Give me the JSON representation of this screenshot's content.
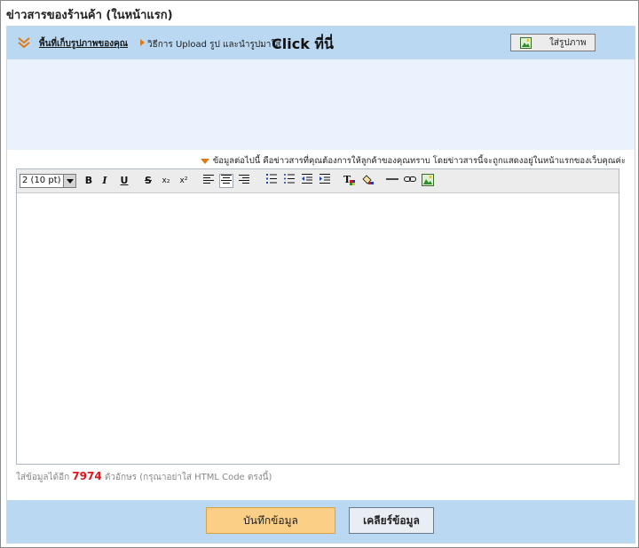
{
  "title": "ข่าวสารของร้านค้า (ในหน้าแรก)",
  "upload": {
    "link_label": "พื้นที่เก็บรูปภาพของคุณ",
    "howto_text": "วิธีการ Upload รูป และนำรูปมาใส่",
    "click_text": "Click ที่นี่",
    "insert_image_button": "ใส่รูปภาพ"
  },
  "note": "ข้อมูลต่อไปนี้ คือข่าวสารที่คุณต้องการให้ลูกค้าของคุณทราบ โดยข่าวสารนี้จะถูกแสดงอยู่ในหน้าแรกของเว็บคุณค่ะ",
  "editor": {
    "font_size": "2 (10 pt)",
    "bold": "B",
    "italic": "I",
    "underline": "U",
    "strike": "S",
    "subscript": "x₂",
    "superscript": "x²",
    "content": ""
  },
  "remaining": {
    "prefix": "ใส่ข้อมูลได้อีก",
    "count": "7974",
    "suffix": "ตัวอักษร (กรุณาอย่าใส่ HTML Code ตรงนี้)"
  },
  "buttons": {
    "save": "บันทึกข้อมูล",
    "clear": "เคลียร์ข้อมูล"
  },
  "colors": {
    "bar_blue": "#bad8f2",
    "preview_blue": "#eaf3fd",
    "accent_orange": "#e07a10",
    "count_red": "#e0151b",
    "save_button": "#fbcf86"
  }
}
